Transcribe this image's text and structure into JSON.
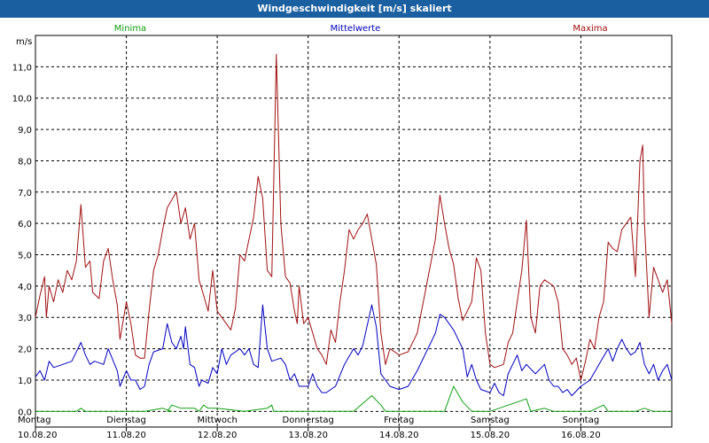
{
  "window": {
    "title": "Windgeschwindigkeit [m/s] skaliert"
  },
  "chart_data": {
    "type": "line",
    "title": "Windgeschwindigkeit [m/s] skaliert",
    "ylabel": "m/s",
    "xlabel": "",
    "ylim": [
      -0.5,
      12.0
    ],
    "yticks": [
      "0,0",
      "1,0",
      "2,0",
      "3,0",
      "4,0",
      "5,0",
      "6,0",
      "7,0",
      "8,0",
      "9,0",
      "10,0",
      "11,0"
    ],
    "ytick_values": [
      0,
      1,
      2,
      3,
      4,
      5,
      6,
      7,
      8,
      9,
      10,
      11
    ],
    "grid": true,
    "legend_position": "top",
    "x_unit": "days",
    "x_range": [
      0,
      7
    ],
    "days": [
      {
        "weekday": "Montag",
        "date": "10.08.20"
      },
      {
        "weekday": "Dienstag",
        "date": "11.08.20"
      },
      {
        "weekday": "Mittwoch",
        "date": "12.08.20"
      },
      {
        "weekday": "Donnerstag",
        "date": "13.08.20"
      },
      {
        "weekday": "Freitag",
        "date": "14.08.20"
      },
      {
        "weekday": "Samstag",
        "date": "15.08.20"
      },
      {
        "weekday": "Sonntag",
        "date": "16.08.20"
      }
    ],
    "series": [
      {
        "name": "Minima",
        "color": "#10a010",
        "points": [
          [
            0.0,
            0.0
          ],
          [
            0.45,
            0.0
          ],
          [
            0.5,
            0.1
          ],
          [
            0.55,
            0.0
          ],
          [
            1.0,
            0.0
          ],
          [
            1.2,
            0.0
          ],
          [
            1.4,
            0.1
          ],
          [
            1.5,
            0.0
          ],
          [
            1.45,
            0.0
          ],
          [
            1.5,
            0.2
          ],
          [
            1.6,
            0.1
          ],
          [
            1.75,
            0.1
          ],
          [
            1.8,
            0.0
          ],
          [
            1.85,
            0.2
          ],
          [
            1.9,
            0.1
          ],
          [
            2.0,
            0.1
          ],
          [
            2.3,
            0.0
          ],
          [
            2.55,
            0.1
          ],
          [
            2.6,
            0.2
          ],
          [
            2.62,
            0.0
          ],
          [
            2.85,
            0.0
          ],
          [
            3.0,
            0.0
          ],
          [
            3.5,
            0.0
          ],
          [
            3.7,
            0.5
          ],
          [
            3.8,
            0.2
          ],
          [
            3.85,
            0.0
          ],
          [
            4.5,
            0.0
          ],
          [
            4.6,
            0.8
          ],
          [
            4.7,
            0.3
          ],
          [
            4.8,
            0.0
          ],
          [
            5.0,
            0.0
          ],
          [
            5.4,
            0.4
          ],
          [
            5.45,
            0.0
          ],
          [
            5.6,
            0.1
          ],
          [
            5.7,
            0.0
          ],
          [
            6.1,
            0.0
          ],
          [
            6.25,
            0.2
          ],
          [
            6.3,
            0.0
          ],
          [
            6.6,
            0.0
          ],
          [
            6.7,
            0.1
          ],
          [
            6.8,
            0.0
          ],
          [
            7.0,
            0.0
          ]
        ]
      },
      {
        "name": "Mittelwerte",
        "color": "#0000c0",
        "points": [
          [
            0.0,
            1.1
          ],
          [
            0.05,
            1.3
          ],
          [
            0.1,
            1.0
          ],
          [
            0.15,
            1.6
          ],
          [
            0.2,
            1.4
          ],
          [
            0.3,
            1.5
          ],
          [
            0.4,
            1.6
          ],
          [
            0.5,
            2.2
          ],
          [
            0.55,
            1.8
          ],
          [
            0.6,
            1.5
          ],
          [
            0.65,
            1.6
          ],
          [
            0.75,
            1.5
          ],
          [
            0.8,
            2.0
          ],
          [
            0.9,
            1.3
          ],
          [
            0.93,
            0.8
          ],
          [
            1.0,
            1.3
          ],
          [
            1.05,
            1.0
          ],
          [
            1.1,
            1.0
          ],
          [
            1.15,
            0.7
          ],
          [
            1.2,
            0.8
          ],
          [
            1.25,
            1.5
          ],
          [
            1.3,
            1.9
          ],
          [
            1.4,
            2.0
          ],
          [
            1.45,
            2.8
          ],
          [
            1.5,
            2.2
          ],
          [
            1.55,
            2.0
          ],
          [
            1.6,
            2.4
          ],
          [
            1.63,
            2.0
          ],
          [
            1.65,
            2.7
          ],
          [
            1.7,
            1.5
          ],
          [
            1.75,
            1.4
          ],
          [
            1.8,
            0.8
          ],
          [
            1.83,
            1.0
          ],
          [
            1.9,
            0.9
          ],
          [
            1.95,
            1.4
          ],
          [
            2.0,
            1.2
          ],
          [
            2.05,
            2.0
          ],
          [
            2.1,
            1.5
          ],
          [
            2.15,
            1.8
          ],
          [
            2.25,
            2.0
          ],
          [
            2.3,
            1.8
          ],
          [
            2.35,
            2.0
          ],
          [
            2.4,
            1.5
          ],
          [
            2.45,
            1.4
          ],
          [
            2.5,
            3.4
          ],
          [
            2.55,
            2.0
          ],
          [
            2.6,
            1.6
          ],
          [
            2.7,
            1.7
          ],
          [
            2.75,
            1.5
          ],
          [
            2.8,
            1.0
          ],
          [
            2.85,
            1.2
          ],
          [
            2.9,
            0.8
          ],
          [
            3.0,
            0.8
          ],
          [
            3.05,
            1.2
          ],
          [
            3.1,
            0.8
          ],
          [
            3.15,
            0.6
          ],
          [
            3.2,
            0.6
          ],
          [
            3.3,
            0.8
          ],
          [
            3.4,
            1.5
          ],
          [
            3.5,
            2.0
          ],
          [
            3.55,
            1.8
          ],
          [
            3.6,
            2.1
          ],
          [
            3.7,
            3.4
          ],
          [
            3.75,
            2.7
          ],
          [
            3.8,
            1.2
          ],
          [
            3.85,
            1.0
          ],
          [
            3.9,
            0.8
          ],
          [
            4.0,
            0.7
          ],
          [
            4.1,
            0.8
          ],
          [
            4.2,
            1.3
          ],
          [
            4.3,
            1.9
          ],
          [
            4.4,
            2.5
          ],
          [
            4.45,
            3.1
          ],
          [
            4.5,
            3.0
          ],
          [
            4.6,
            2.6
          ],
          [
            4.7,
            2.0
          ],
          [
            4.75,
            1.1
          ],
          [
            4.8,
            1.5
          ],
          [
            4.85,
            1.0
          ],
          [
            4.9,
            0.7
          ],
          [
            5.0,
            0.6
          ],
          [
            5.05,
            0.9
          ],
          [
            5.1,
            0.6
          ],
          [
            5.15,
            0.5
          ],
          [
            5.2,
            1.2
          ],
          [
            5.3,
            1.8
          ],
          [
            5.35,
            1.3
          ],
          [
            5.4,
            1.5
          ],
          [
            5.5,
            1.2
          ],
          [
            5.6,
            1.5
          ],
          [
            5.65,
            1.0
          ],
          [
            5.7,
            0.8
          ],
          [
            5.75,
            0.8
          ],
          [
            5.8,
            0.6
          ],
          [
            5.85,
            0.7
          ],
          [
            5.9,
            0.5
          ],
          [
            6.0,
            0.8
          ],
          [
            6.1,
            1.0
          ],
          [
            6.2,
            1.5
          ],
          [
            6.3,
            2.0
          ],
          [
            6.35,
            1.6
          ],
          [
            6.4,
            2.0
          ],
          [
            6.45,
            2.3
          ],
          [
            6.5,
            2.0
          ],
          [
            6.55,
            1.8
          ],
          [
            6.6,
            1.9
          ],
          [
            6.65,
            2.2
          ],
          [
            6.7,
            1.5
          ],
          [
            6.75,
            1.2
          ],
          [
            6.8,
            1.5
          ],
          [
            6.85,
            1.0
          ],
          [
            6.9,
            1.3
          ],
          [
            6.95,
            1.5
          ],
          [
            7.0,
            1.0
          ]
        ]
      },
      {
        "name": "Maxima",
        "color": "#a01010",
        "points": [
          [
            0.0,
            3.0
          ],
          [
            0.05,
            3.7
          ],
          [
            0.1,
            4.3
          ],
          [
            0.12,
            3.0
          ],
          [
            0.15,
            4.0
          ],
          [
            0.2,
            3.5
          ],
          [
            0.25,
            4.2
          ],
          [
            0.3,
            3.8
          ],
          [
            0.35,
            4.5
          ],
          [
            0.4,
            4.2
          ],
          [
            0.45,
            4.8
          ],
          [
            0.5,
            6.6
          ],
          [
            0.55,
            4.6
          ],
          [
            0.6,
            4.8
          ],
          [
            0.63,
            3.8
          ],
          [
            0.7,
            3.6
          ],
          [
            0.75,
            4.8
          ],
          [
            0.8,
            5.2
          ],
          [
            0.85,
            4.2
          ],
          [
            0.9,
            3.4
          ],
          [
            0.93,
            2.3
          ],
          [
            1.0,
            3.5
          ],
          [
            1.05,
            2.8
          ],
          [
            1.1,
            1.8
          ],
          [
            1.15,
            1.7
          ],
          [
            1.2,
            1.7
          ],
          [
            1.25,
            3.2
          ],
          [
            1.3,
            4.5
          ],
          [
            1.35,
            5.0
          ],
          [
            1.4,
            5.8
          ],
          [
            1.45,
            6.5
          ],
          [
            1.55,
            7.0
          ],
          [
            1.6,
            6.0
          ],
          [
            1.65,
            6.5
          ],
          [
            1.7,
            5.5
          ],
          [
            1.75,
            6.0
          ],
          [
            1.8,
            4.2
          ],
          [
            1.85,
            3.7
          ],
          [
            1.9,
            3.2
          ],
          [
            1.95,
            4.5
          ],
          [
            2.0,
            3.2
          ],
          [
            2.1,
            2.8
          ],
          [
            2.15,
            2.6
          ],
          [
            2.2,
            3.3
          ],
          [
            2.25,
            5.0
          ],
          [
            2.3,
            4.8
          ],
          [
            2.35,
            5.5
          ],
          [
            2.4,
            6.2
          ],
          [
            2.45,
            7.5
          ],
          [
            2.5,
            6.8
          ],
          [
            2.55,
            4.5
          ],
          [
            2.6,
            4.3
          ],
          [
            2.65,
            11.4
          ],
          [
            2.7,
            6.0
          ],
          [
            2.75,
            4.3
          ],
          [
            2.8,
            4.1
          ],
          [
            2.85,
            3.2
          ],
          [
            2.88,
            2.8
          ],
          [
            2.9,
            4.0
          ],
          [
            2.95,
            2.8
          ],
          [
            3.0,
            3.0
          ],
          [
            3.05,
            2.5
          ],
          [
            3.1,
            2.0
          ],
          [
            3.15,
            1.8
          ],
          [
            3.2,
            1.5
          ],
          [
            3.25,
            2.6
          ],
          [
            3.3,
            2.2
          ],
          [
            3.35,
            3.5
          ],
          [
            3.4,
            4.5
          ],
          [
            3.45,
            5.8
          ],
          [
            3.5,
            5.5
          ],
          [
            3.55,
            5.8
          ],
          [
            3.6,
            6.0
          ],
          [
            3.65,
            6.3
          ],
          [
            3.7,
            5.5
          ],
          [
            3.75,
            4.7
          ],
          [
            3.8,
            2.5
          ],
          [
            3.85,
            1.5
          ],
          [
            3.9,
            2.0
          ],
          [
            3.95,
            1.9
          ],
          [
            4.0,
            1.8
          ],
          [
            4.1,
            1.9
          ],
          [
            4.2,
            2.5
          ],
          [
            4.3,
            4.0
          ],
          [
            4.4,
            5.5
          ],
          [
            4.45,
            6.9
          ],
          [
            4.5,
            6.0
          ],
          [
            4.55,
            5.2
          ],
          [
            4.6,
            4.7
          ],
          [
            4.65,
            3.6
          ],
          [
            4.7,
            2.9
          ],
          [
            4.75,
            3.2
          ],
          [
            4.8,
            3.5
          ],
          [
            4.85,
            4.9
          ],
          [
            4.9,
            4.5
          ],
          [
            4.95,
            2.5
          ],
          [
            5.0,
            1.5
          ],
          [
            5.05,
            1.4
          ],
          [
            5.15,
            1.5
          ],
          [
            5.2,
            2.2
          ],
          [
            5.25,
            2.5
          ],
          [
            5.3,
            3.5
          ],
          [
            5.35,
            4.5
          ],
          [
            5.4,
            6.1
          ],
          [
            5.45,
            3.0
          ],
          [
            5.5,
            2.5
          ],
          [
            5.55,
            4.0
          ],
          [
            5.6,
            4.2
          ],
          [
            5.7,
            4.0
          ],
          [
            5.75,
            3.5
          ],
          [
            5.8,
            2.0
          ],
          [
            5.85,
            1.8
          ],
          [
            5.9,
            1.5
          ],
          [
            5.95,
            1.7
          ],
          [
            6.0,
            1.0
          ],
          [
            6.05,
            1.6
          ],
          [
            6.1,
            2.3
          ],
          [
            6.15,
            2.0
          ],
          [
            6.2,
            3.0
          ],
          [
            6.25,
            3.5
          ],
          [
            6.3,
            5.4
          ],
          [
            6.35,
            5.2
          ],
          [
            6.4,
            5.1
          ],
          [
            6.45,
            5.8
          ],
          [
            6.5,
            6.0
          ],
          [
            6.55,
            6.2
          ],
          [
            6.6,
            4.3
          ],
          [
            6.65,
            8.0
          ],
          [
            6.68,
            8.5
          ],
          [
            6.7,
            6.0
          ],
          [
            6.75,
            3.0
          ],
          [
            6.8,
            4.6
          ],
          [
            6.85,
            4.2
          ],
          [
            6.9,
            3.8
          ],
          [
            6.95,
            4.2
          ],
          [
            7.0,
            2.8
          ]
        ]
      }
    ]
  }
}
